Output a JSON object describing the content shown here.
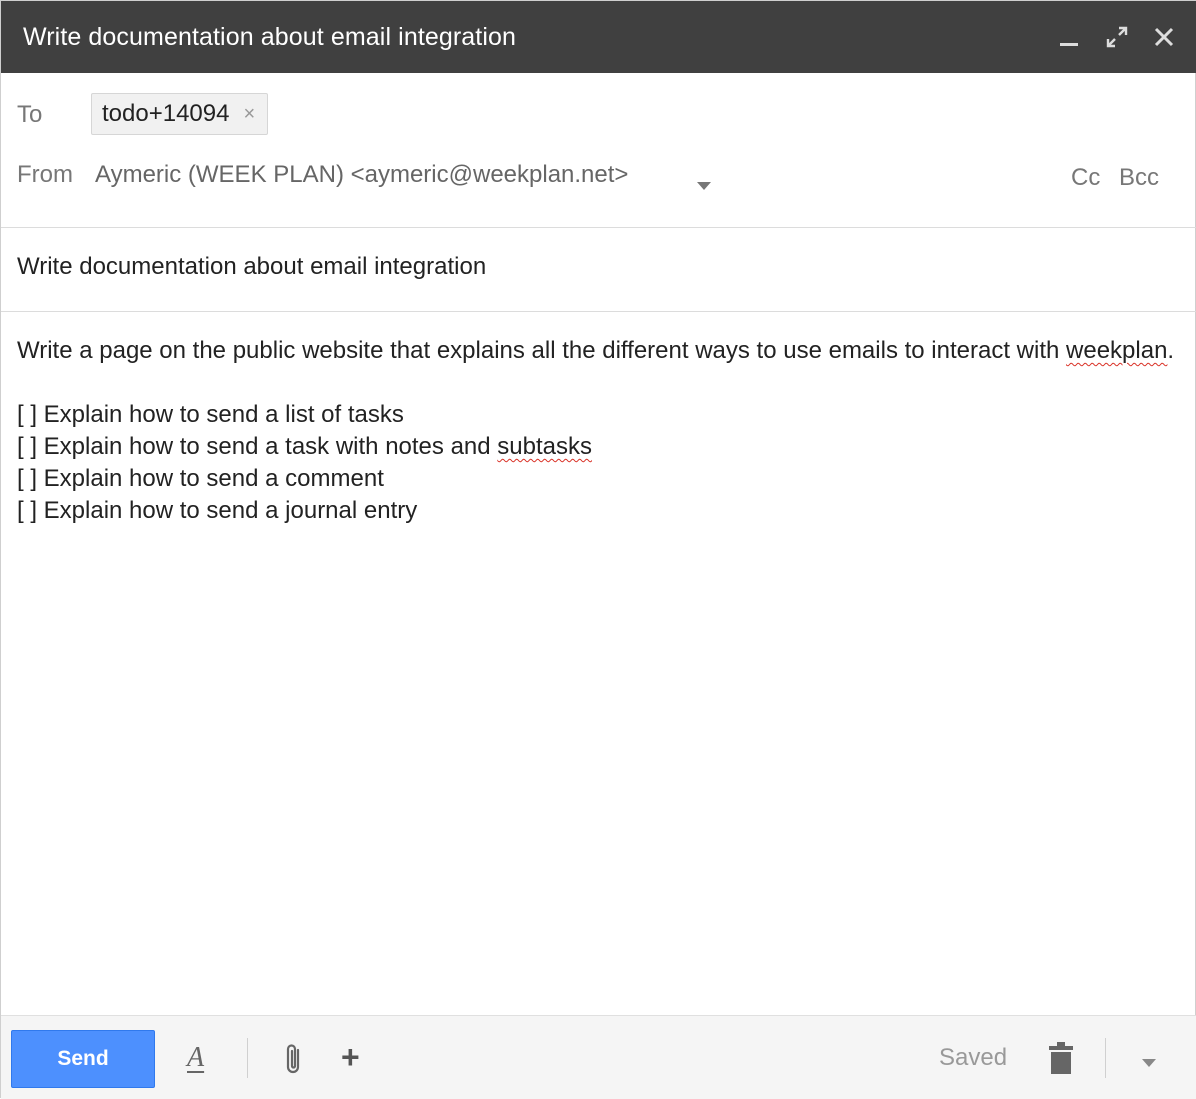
{
  "window": {
    "title": "Write documentation about email integration"
  },
  "recipients": {
    "to_label": "To",
    "to_chip": "todo+14094",
    "chip_remove_glyph": "×",
    "from_label": "From",
    "from_value": "Aymeric (WEEK PLAN) <aymeric@weekplan.net>",
    "cc_label": "Cc",
    "bcc_label": "Bcc"
  },
  "subject": "Write documentation about email integration",
  "body": {
    "line1_before": "Write a page on the public website that explains all the different ways to use emails to interact with ",
    "line1_misspelled": "weekplan",
    "line1_after": ".",
    "items": [
      {
        "text": "[ ] Explain how to send a list of tasks"
      },
      {
        "text_before": "[ ] Explain how to send a task with notes and ",
        "misspelled": "subtasks"
      },
      {
        "text": "[ ] Explain how to send a comment"
      },
      {
        "text": "[ ] Explain how to send a journal entry"
      }
    ]
  },
  "toolbar": {
    "send_label": "Send",
    "format_glyph": "A",
    "add_glyph": "+",
    "saved_label": "Saved"
  },
  "icons": {
    "minimize": "minimize-icon",
    "expand": "expand-icon",
    "close": "close-icon",
    "from_dropdown": "caret-down-icon",
    "attach": "paperclip-icon",
    "delete": "trash-icon",
    "more": "caret-down-icon"
  },
  "colors": {
    "titlebar": "#404040",
    "send_button": "#4d90fe",
    "spellcheck": "#d93025"
  }
}
